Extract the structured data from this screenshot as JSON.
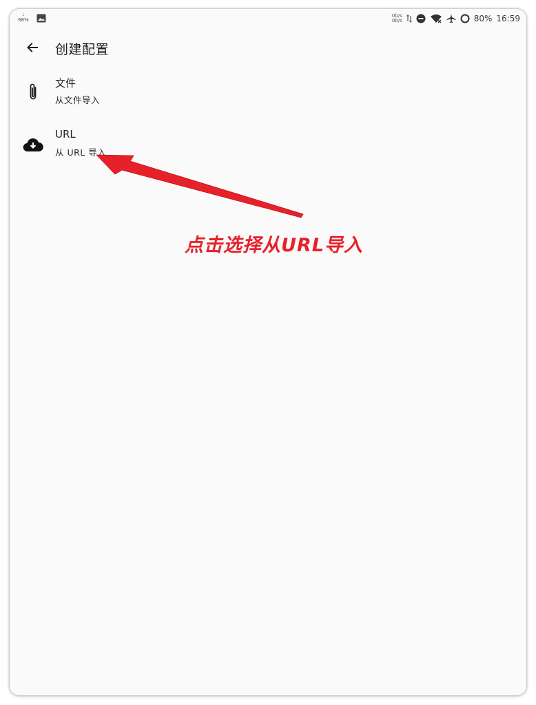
{
  "status_bar": {
    "battery_mini": "68%",
    "net_up": "0b/s",
    "net_down": "0b/s",
    "battery_percent": "80%",
    "time": "16:59",
    "icons": [
      "battery-saver-icon",
      "gallery-icon",
      "data-arrows-icon",
      "dnd-icon",
      "wifi-off-icon",
      "airplane-icon",
      "battery-ring-icon"
    ]
  },
  "toolbar": {
    "title": "创建配置",
    "back_icon": "arrow-left-icon"
  },
  "items": [
    {
      "title": "文件",
      "subtitle": "从文件导入",
      "icon": "paperclip-icon"
    },
    {
      "title": "URL",
      "subtitle": "从 URL 导入",
      "icon": "cloud-download-icon"
    }
  ],
  "annotation": {
    "text": "点击选择从URL导入",
    "color": "#e6212a"
  }
}
